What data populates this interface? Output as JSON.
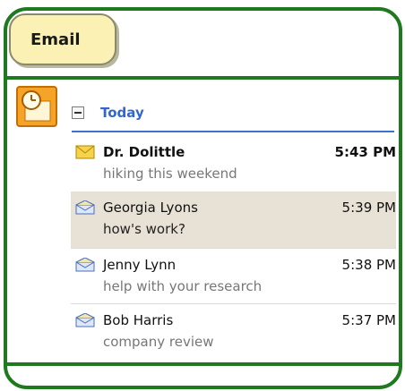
{
  "panel": {
    "title": "Email"
  },
  "group": {
    "label": "Today",
    "collapse_symbol": "−"
  },
  "messages": [
    {
      "from": "Dr. Dolittle",
      "subject": "hiking this weekend",
      "time": "5:43 PM",
      "unread": true,
      "icon": "closed-envelope-icon"
    },
    {
      "from": "Georgia Lyons",
      "subject": "how's work?",
      "time": "5:39 PM",
      "unread": false,
      "icon": "open-envelope-icon"
    },
    {
      "from": "Jenny Lynn",
      "subject": "help with your research",
      "time": "5:38 PM",
      "unread": false,
      "icon": "open-envelope-icon"
    },
    {
      "from": "Bob Harris",
      "subject": "company review",
      "time": "5:37 PM",
      "unread": false,
      "icon": "open-envelope-icon"
    }
  ],
  "colors": {
    "frame": "#1f7a1f",
    "tab_bg": "#fbf1b4",
    "today": "#3366cc",
    "selected_row": "#e8e2d6"
  }
}
